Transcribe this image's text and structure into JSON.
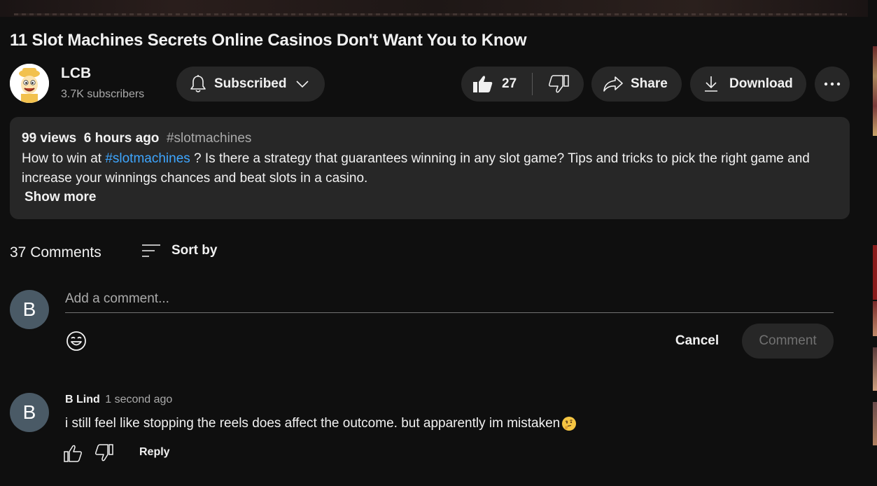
{
  "video": {
    "title": "11 Slot Machines Secrets Online Casinos Don't Want You to Know"
  },
  "channel": {
    "name": "LCB",
    "subscribers": "3.7K subscribers",
    "subscribe_label": "Subscribed"
  },
  "actions": {
    "like_count": "27",
    "share_label": "Share",
    "download_label": "Download"
  },
  "description": {
    "views": "99 views",
    "uploaded": "6 hours ago",
    "hashtag": "#slotmachines",
    "text_before_link": "How to win at ",
    "link": "#slotmachines",
    "text_after_link": " ? Is there a strategy that guarantees winning in any slot game? Tips and tricks to pick the right game and increase your winnings chances and beat slots in a casino.",
    "show_more": "Show more"
  },
  "comments_section": {
    "count_label": "37 Comments",
    "sort_label": "Sort by",
    "user_initial": "B",
    "placeholder": "Add a comment...",
    "cancel_label": "Cancel",
    "comment_label": "Comment"
  },
  "comments": [
    {
      "initial": "B",
      "author": "B Lind",
      "time": "1 second ago",
      "text": "i still feel like stopping the reels does affect the outcome. but apparently im mistaken",
      "emoji": "thinking-face",
      "reply_label": "Reply"
    }
  ],
  "colors": {
    "background": "#0f0f0f",
    "surface": "#272727",
    "text": "#f1f1f1",
    "secondary_text": "#aaaaaa",
    "link": "#3ea6ff",
    "avatar_b": "#4a5a66"
  },
  "icons": [
    "bell-icon",
    "chevron-down-icon",
    "thumbs-up-icon",
    "thumbs-down-icon",
    "share-icon",
    "download-icon",
    "more-icon",
    "sort-icon",
    "emoji-icon",
    "thinking-face-icon"
  ]
}
